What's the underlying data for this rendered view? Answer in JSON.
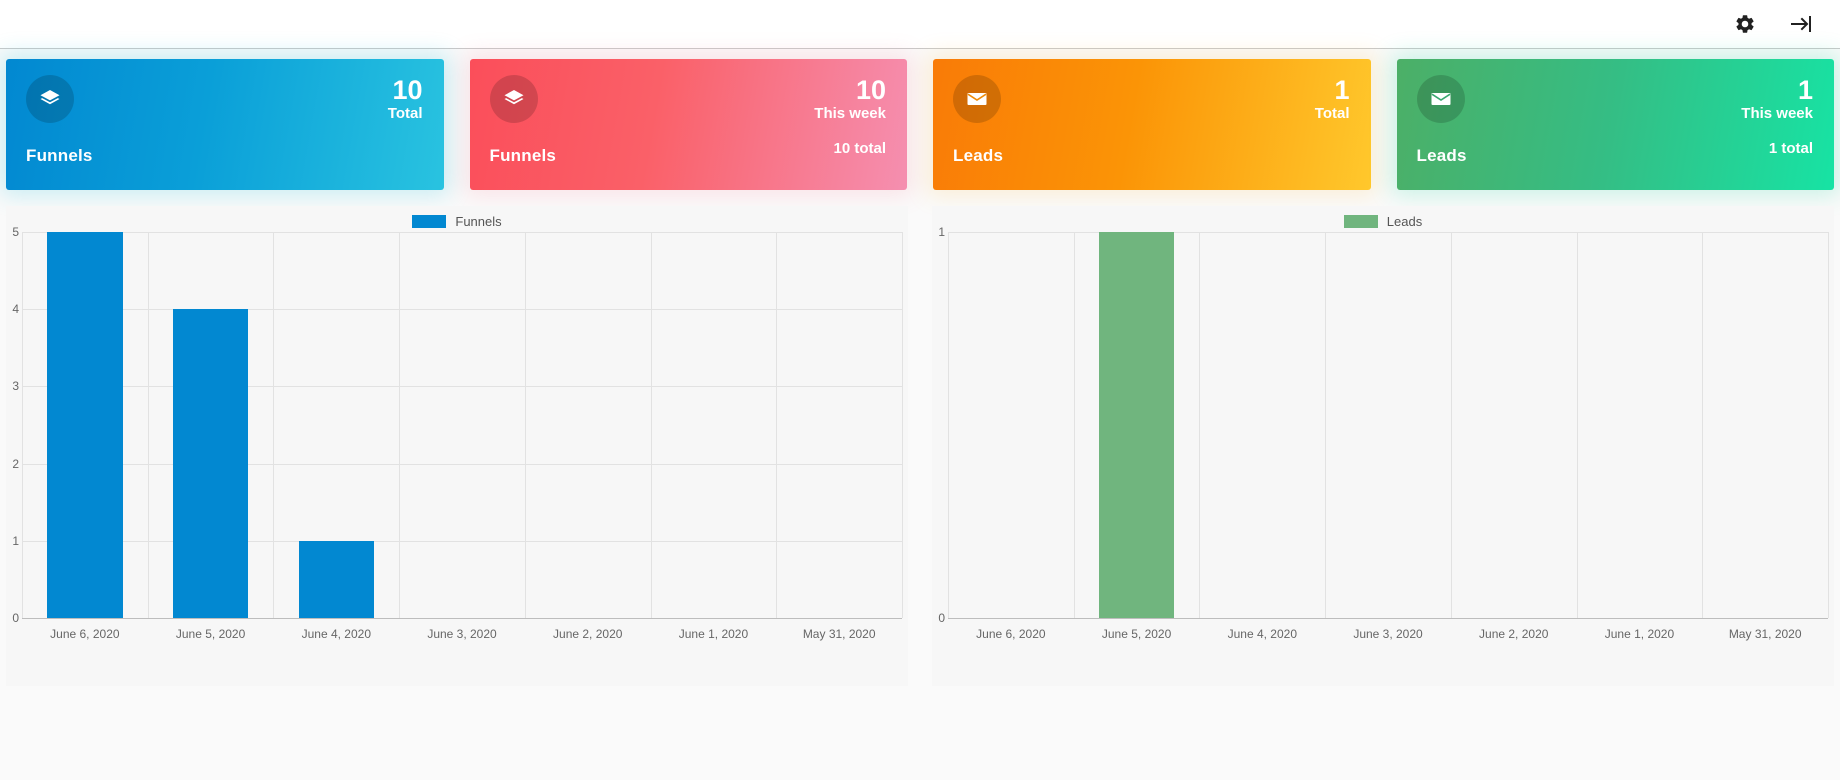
{
  "header": {
    "settings_icon": "gear-icon",
    "logout_icon": "sign-out-icon"
  },
  "cards": [
    {
      "id": "funnels-total",
      "title": "Funnels",
      "value": "10",
      "label": "Total",
      "sub": "",
      "icon": "layers-icon",
      "color": "#0288d1"
    },
    {
      "id": "funnels-this-week",
      "title": "Funnels",
      "value": "10",
      "label": "This week",
      "sub": "10 total",
      "icon": "layers-icon",
      "color": "#fb4e5a"
    },
    {
      "id": "leads-total",
      "title": "Leads",
      "value": "1",
      "label": "Total",
      "sub": "",
      "icon": "mail-icon",
      "color": "#f97b07"
    },
    {
      "id": "leads-this-week",
      "title": "Leads",
      "value": "1",
      "label": "This week",
      "sub": "1 total",
      "icon": "mail-icon",
      "color": "#35bd84"
    }
  ],
  "chart_data": [
    {
      "type": "bar",
      "title": "",
      "xlabel": "",
      "ylabel": "",
      "legend": "Funnels",
      "legend_position": "top-center",
      "color": "#0288d1",
      "grid": true,
      "ylim": [
        0,
        5
      ],
      "yticks": [
        "5",
        "4",
        "3",
        "2",
        "1",
        "0"
      ],
      "categories": [
        "June 6, 2020",
        "June 5, 2020",
        "June 4, 2020",
        "June 3, 2020",
        "June 2, 2020",
        "June 1, 2020",
        "May 31, 2020"
      ],
      "values": [
        5,
        4,
        1,
        0,
        0,
        0,
        0
      ]
    },
    {
      "type": "bar",
      "title": "",
      "xlabel": "",
      "ylabel": "",
      "legend": "Leads",
      "legend_position": "top-center",
      "color": "#70b57e",
      "grid": true,
      "ylim": [
        0,
        1
      ],
      "yticks": [
        "1",
        "0"
      ],
      "categories": [
        "June 6, 2020",
        "June 5, 2020",
        "June 4, 2020",
        "June 3, 2020",
        "June 2, 2020",
        "June 1, 2020",
        "May 31, 2020"
      ],
      "values": [
        0,
        1,
        0,
        0,
        0,
        0,
        0
      ]
    }
  ]
}
